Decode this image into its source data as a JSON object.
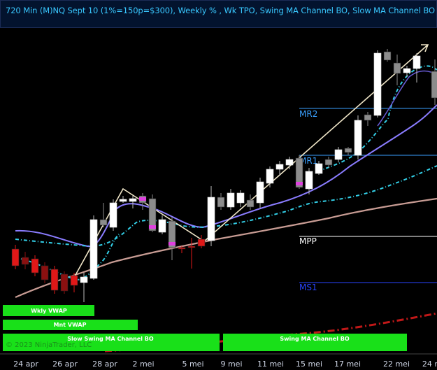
{
  "title": "720 Min (M)NQ Sept 10 (1%=150p=$300), Weekly % , Wk TPO, Swing MA Channel BO, Slow MA Channel BO",
  "levels": [
    {
      "label": "MR2",
      "color": "#3aa0ff"
    },
    {
      "label": "MR1",
      "color": "#3aa0ff"
    },
    {
      "label": "MPP",
      "color": "#ffffff"
    },
    {
      "label": "MS1",
      "color": "#2a45ff"
    }
  ],
  "indicator_bars": [
    {
      "label": "Wkly VWAP"
    },
    {
      "label": "Mnt VWAP"
    },
    {
      "label": "Slow Swing MA Channel BO"
    },
    {
      "label": "Swing MA Channel BO"
    }
  ],
  "copyright": "© 2023 NinjaTrader, LLC",
  "x_axis_labels": [
    "24 apr",
    "26 apr",
    "28 apr",
    "2 mei",
    "5 mei",
    "9 mei",
    "11 mei",
    "15 mei",
    "17 mei",
    "22 mei",
    "24 m"
  ],
  "colors": {
    "bull_candle": "#ffffff",
    "bear_candle": "#8c8c8c",
    "down_strong": "#e01818",
    "down_dark": "#8b1010",
    "fast_ma": "#8a7cff",
    "slow_ma": "#c89c94",
    "dotted_channel": "#33d0e8",
    "indicator_green": "#19e019",
    "trend_line": "#f0e6c8",
    "vwap_dashdot": "#c01818"
  }
}
